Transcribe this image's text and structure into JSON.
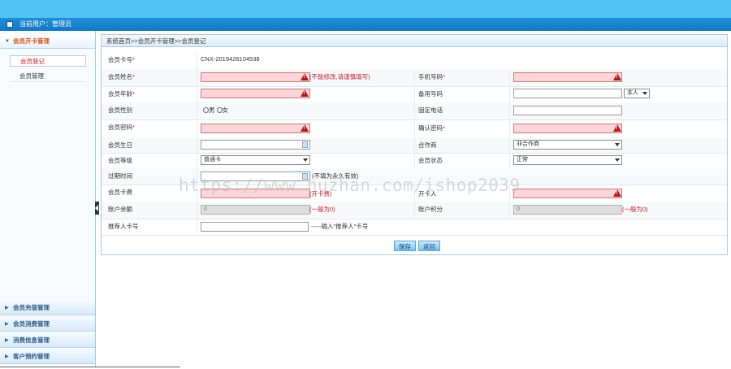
{
  "header": {
    "user_label": "当前用户：管理员"
  },
  "sidebar": {
    "groups": [
      {
        "label": "会员开卡管理"
      },
      {
        "label": "会员充值管理"
      },
      {
        "label": "会员消费管理"
      },
      {
        "label": "消费信息管理"
      },
      {
        "label": "客户预约管理"
      }
    ],
    "subitems": [
      {
        "label": "会员登记"
      },
      {
        "label": "会员管理"
      }
    ]
  },
  "breadcrumb": "系统首页>>会员开卡管理>>会员登记",
  "form": {
    "card_no_label": "会员卡号",
    "card_no_value": "CNX-2019428104538",
    "name_label": "会员姓名",
    "name_note": "(不能修改,请谨慎填写)",
    "phone_label": "手机号码",
    "age_label": "会员年龄",
    "backup_phone_label": "备用号码",
    "backup_phone_select": "本人",
    "gender_label": "会员性别",
    "gender_male": "男",
    "gender_female": "女",
    "landline_label": "固定电话",
    "password_label": "会员密码",
    "confirm_password_label": "确认密码",
    "birthday_label": "会员生日",
    "partner_label": "合作商",
    "partner_value": "非合作商",
    "level_label": "会员等级",
    "level_value": "普通卡",
    "status_label": "会员状态",
    "status_value": "正常",
    "expire_label": "过期时间",
    "expire_note": "(不填为永久有效)",
    "fee_label": "会员卡费",
    "fee_note": "(开卡费)",
    "opener_label": "开卡人",
    "balance_label": "账户余额",
    "balance_value": "0",
    "balance_note": "(一般为0)",
    "points_label": "账户积分",
    "points_value": "0",
    "points_note": "(一般为0)",
    "referrer_label": "推荐人卡号",
    "referrer_note": "-----输入\"推荐人\"卡号",
    "save_label": "保存",
    "back_label": "返回",
    "required_mark": "*"
  },
  "watermark": "https://www.huzhan.com/ishop2039",
  "colors": {
    "topbar": "#4fc3f4",
    "userbar": "#1478c2",
    "error_input": "#fbd5d8",
    "error_text": "#c0202b"
  }
}
